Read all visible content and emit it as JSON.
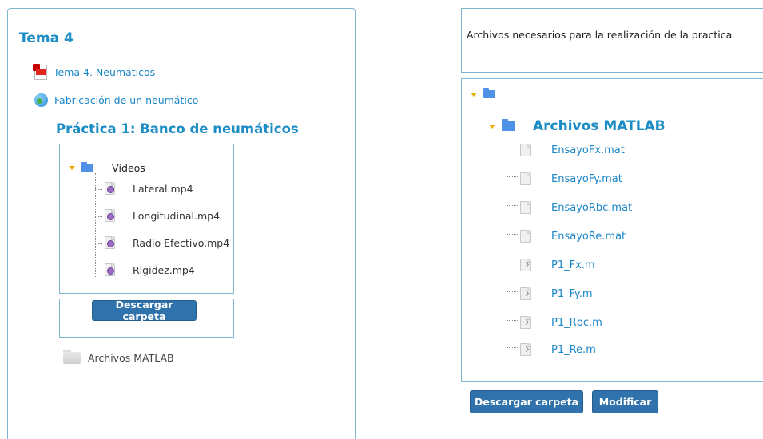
{
  "left": {
    "section_title": "Tema 4",
    "resources": [
      {
        "label": "Tema 4. Neumáticos",
        "icon": "pdf-icon"
      },
      {
        "label": "Fabricación de un neumático",
        "icon": "globe-icon"
      }
    ],
    "subsection_title": "Práctica 1: Banco de neumáticos",
    "tree": {
      "folder": "Vídeos",
      "files": [
        "Lateral.mp4",
        "Longitudinal.mp4",
        "Radio Efectivo.mp4",
        "Rigidez.mp4"
      ]
    },
    "download_label": "Descargar carpeta",
    "matlab_folder": "Archivos MATLAB"
  },
  "right": {
    "description": "Archivos necesarios para la realización de la practica",
    "tree": {
      "folder": "Archivos MATLAB",
      "files": [
        "EnsayoFx.mat",
        "EnsayoFy.mat",
        "EnsayoRbc.mat",
        "EnsayoRe.mat",
        "P1_Fx.m",
        "P1_Fy.m",
        "P1_Rbc.m",
        "P1_Re.m"
      ]
    },
    "download_label": "Descargar carpeta",
    "modify_label": "Modificar"
  },
  "colors": {
    "accent": "#1b8cc4",
    "link": "#1a86c7",
    "button": "#3072ab",
    "border": "#7fb6cf",
    "caret": "#f0a800"
  }
}
